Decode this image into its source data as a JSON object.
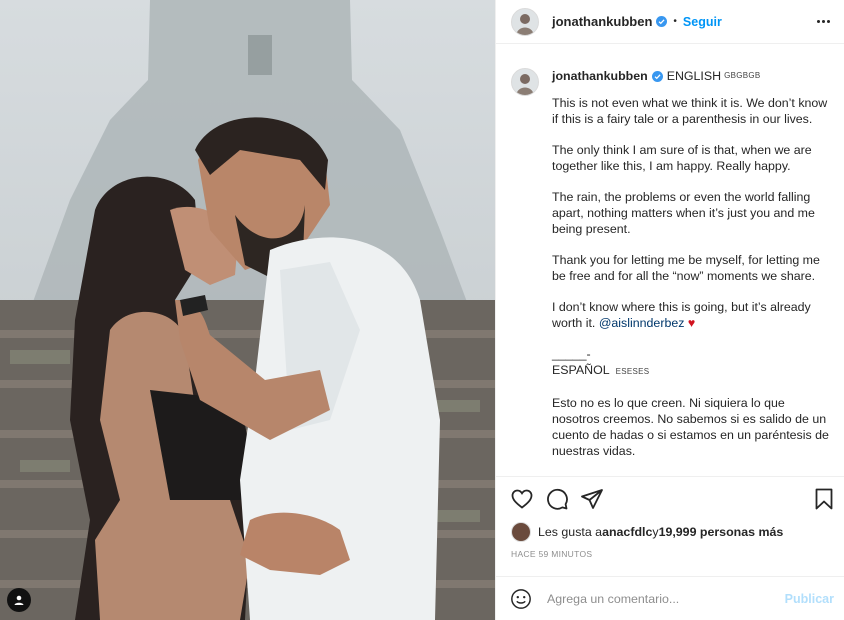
{
  "post": {
    "username": "jonathankubben",
    "follow_label": "Seguir",
    "separator": "•"
  },
  "caption": {
    "username": "jonathankubben",
    "lang_en": "ENGLISH",
    "flag_en": "GBGBGB",
    "paragraphs": [
      "This is not even what we think it is. We don’t know if this is a fairy tale or a parenthesis in our lives.",
      "The only think I am sure of is that, when we are together like this, I am happy. Really happy.",
      "The rain, the problems or even the world falling apart, nothing matters when it’s just you and me being present.",
      "Thank you for letting me be myself, for letting me be free and for all the “now” moments we share."
    ],
    "p5_text": "I don’t know where this is going, but it’s already worth it. ",
    "mention": "@aislinnderbez",
    "heart": "♥",
    "divider": "_____-",
    "lang_es": "ESPAÑOL",
    "flag_es": "ESESES",
    "spanish": "Esto no es lo que creen. Ni siquiera lo que nosotros creemos. No sabemos si es salido de un cuento de hadas o si estamos en un paréntesis de nuestras vidas."
  },
  "likes": {
    "prefix": "Les gusta a ",
    "user": "anacfdlc",
    "middle": " y ",
    "count": "19,999 personas más"
  },
  "timestamp": "HACE 59 MINUTOS",
  "comment": {
    "placeholder": "Agrega un comentario...",
    "post_label": "Publicar"
  },
  "colors": {
    "accent": "#0095f6",
    "verified": "#3897f0",
    "heart": "#d1121f",
    "publish_disabled": "#b2dffc"
  },
  "icons": [
    "heart-icon",
    "comment-icon",
    "share-icon",
    "bookmark-icon",
    "emoji-icon",
    "verified-badge-icon",
    "more-options-icon",
    "user-tag-icon"
  ]
}
